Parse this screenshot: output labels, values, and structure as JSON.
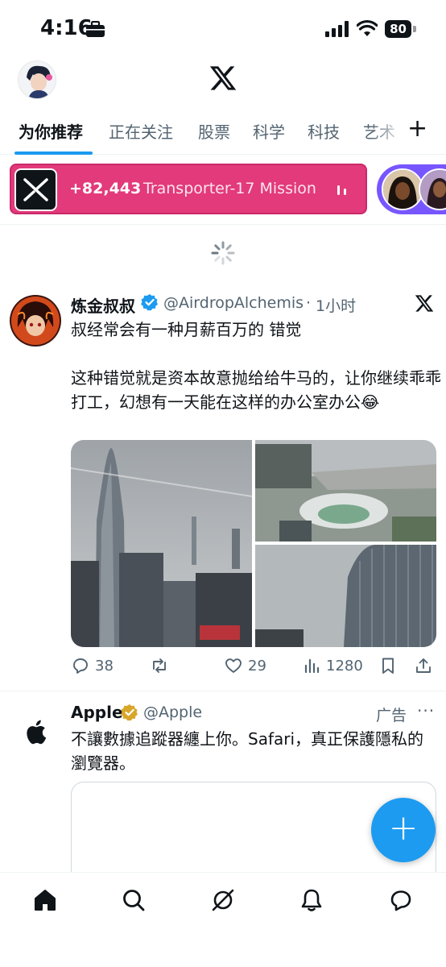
{
  "status_bar": {
    "time": "4:16",
    "battery": "80"
  },
  "tabs": [
    {
      "label": "为你推荐",
      "active": true
    },
    {
      "label": "正在关注"
    },
    {
      "label": "股票"
    },
    {
      "label": "科学"
    },
    {
      "label": "科技"
    },
    {
      "label": "艺术"
    }
  ],
  "space": {
    "count": "+82,443",
    "title": "Transporter-17 Mission"
  },
  "tweet": {
    "name": "炼金叔叔",
    "handle": "@AirdropAlchemis",
    "separator": "·",
    "time": "1小时",
    "text": "叔经常会有一种月薪百万的 错觉\n\n这种错觉就是资本故意抛给给牛马的，让你继续乖乖打工，幻想有一天能在这样的办公室办公😂",
    "replies": "38",
    "likes": "29",
    "views": "1280"
  },
  "ad": {
    "name": "Apple",
    "handle": "@Apple",
    "label": "广告",
    "more": "···",
    "text": "不讓數據追蹤器纏上你。Safari，真正保護隱私的瀏覽器。"
  },
  "fab_label": "+",
  "colors": {
    "accent": "#1d9bf0",
    "space": "#e23a7b",
    "space_host": "#7856ff"
  }
}
